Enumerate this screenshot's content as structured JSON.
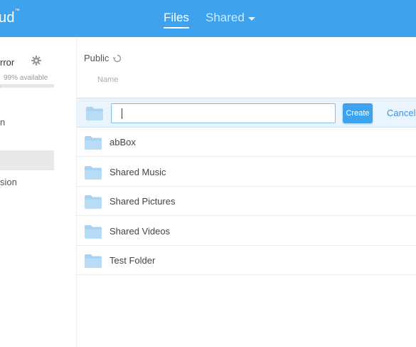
{
  "header": {
    "brand": "ud",
    "brand_mark": "™",
    "nav": [
      {
        "label": "Files",
        "active": true
      },
      {
        "label": "Shared",
        "active": false
      }
    ],
    "accent_color": "#3da3ee"
  },
  "sidebar": {
    "device_name": "rror",
    "available_text": "99% available",
    "storage_used_fraction": 0.01,
    "items": [
      {
        "label": "n"
      },
      {
        "label": ""
      },
      {
        "label": "sion"
      }
    ]
  },
  "main": {
    "breadcrumb": "Public",
    "column_header": "Name",
    "new_folder": {
      "value": "",
      "create_label": "Create",
      "cancel_label": "Cancel"
    },
    "folders": [
      {
        "name": "abBox"
      },
      {
        "name": "Shared Music"
      },
      {
        "name": "Shared Pictures"
      },
      {
        "name": "Shared Videos"
      },
      {
        "name": "Test Folder"
      }
    ]
  }
}
